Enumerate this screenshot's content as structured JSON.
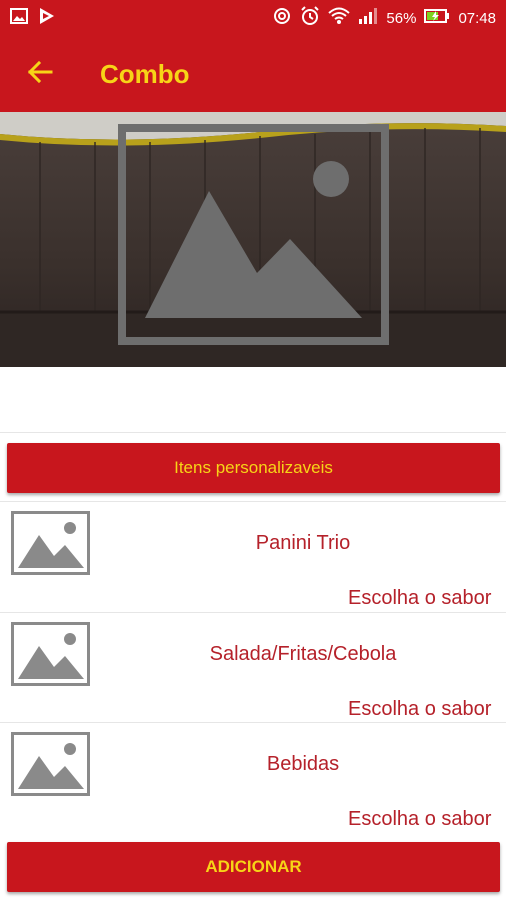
{
  "status_bar": {
    "battery": "56%",
    "time": "07:48"
  },
  "app_bar": {
    "title": "Combo"
  },
  "custom_items_label": "Itens personalizaveis",
  "items": [
    {
      "name": "Panini Trio",
      "choose_label": "Escolha o sabor"
    },
    {
      "name": "Salada/Fritas/Cebola",
      "choose_label": "Escolha o sabor"
    },
    {
      "name": "Bebidas",
      "choose_label": "Escolha o sabor"
    }
  ],
  "add_button_label": "ADICIONAR",
  "colors": {
    "primary": "#c8161d",
    "accent": "#f7d417",
    "item_text": "#b5212a"
  }
}
